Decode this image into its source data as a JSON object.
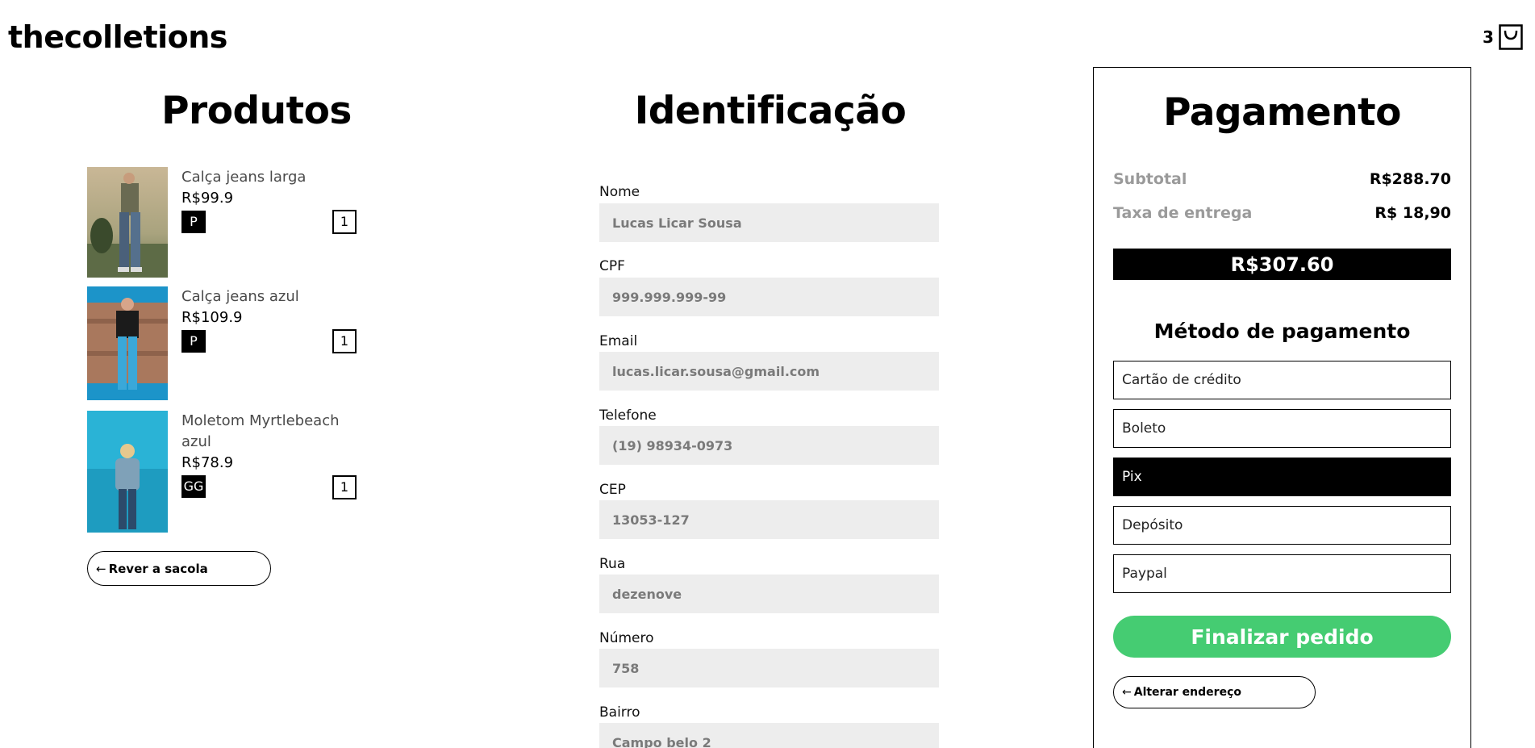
{
  "header": {
    "logo": "thecolletions",
    "cart_count": "3"
  },
  "products": {
    "title": "Produtos",
    "items": [
      {
        "name": "Calça jeans larga",
        "price": "R$99.9",
        "size": "P",
        "qty": "1"
      },
      {
        "name": "Calça jeans azul",
        "price": "R$109.9",
        "size": "P",
        "qty": "1"
      },
      {
        "name": "Moletom Myrtlebeach azul",
        "price": "R$78.9",
        "size": "GG",
        "qty": "1"
      }
    ],
    "back_button": "Rever a sacola"
  },
  "identification": {
    "title": "Identificação",
    "fields": [
      {
        "label": "Nome",
        "value": "Lucas Licar Sousa"
      },
      {
        "label": "CPF",
        "value": "999.999.999-99"
      },
      {
        "label": "Email",
        "value": "lucas.licar.sousa@gmail.com"
      },
      {
        "label": "Telefone",
        "value": "(19) 98934-0973"
      },
      {
        "label": "CEP",
        "value": "13053-127"
      },
      {
        "label": "Rua",
        "value": "dezenove"
      },
      {
        "label": "Número",
        "value": "758"
      },
      {
        "label": "Bairro",
        "value": "Campo belo 2"
      }
    ]
  },
  "payment": {
    "title": "Pagamento",
    "subtotal_label": "Subtotal",
    "subtotal_value": "R$288.70",
    "delivery_label": "Taxa de entrega",
    "delivery_value": "R$ 18,90",
    "total": "R$307.60",
    "method_title": "Método de pagamento",
    "methods": [
      "Cartão de crédito",
      "Boleto",
      "Pix",
      "Depósito",
      "Paypal"
    ],
    "selected_method": "Pix",
    "finalize_button": "Finalizar pedido",
    "change_address_button": "Alterar endereço"
  },
  "colors": {
    "accent_green": "#45cc72",
    "input_bg": "#ededed",
    "muted_text": "#9a9a9a"
  }
}
